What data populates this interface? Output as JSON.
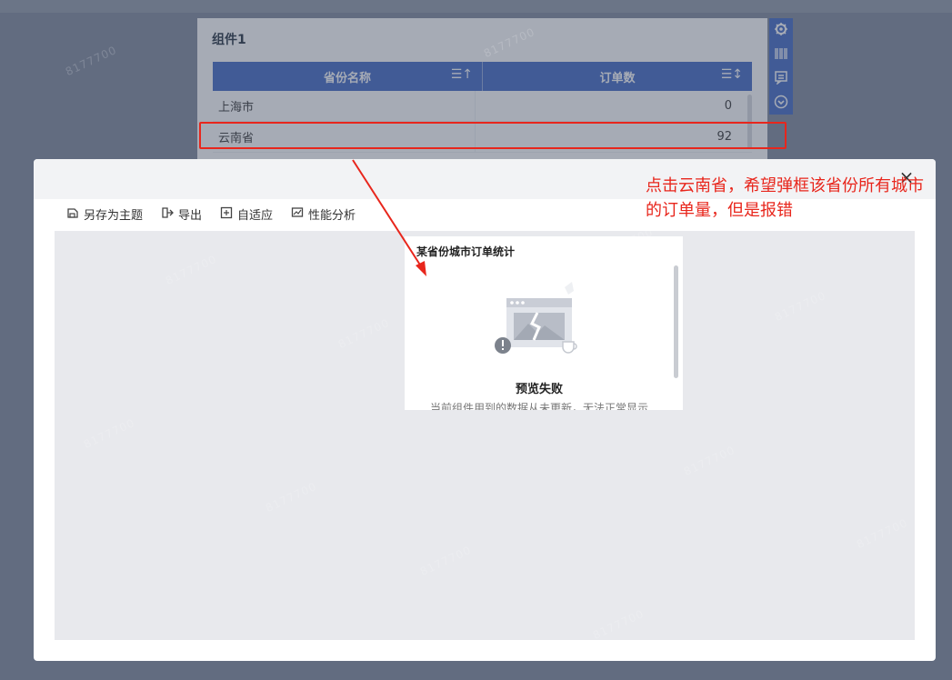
{
  "widget": {
    "title": "组件1",
    "columns": [
      "省份名称",
      "订单数"
    ],
    "sort_icons": [
      "☰↑",
      "☰↕"
    ],
    "rows": [
      {
        "province": "上海市",
        "orders": "0"
      },
      {
        "province": "云南省",
        "orders": "92"
      }
    ]
  },
  "side_toolbar": {
    "icons": [
      "gear-icon",
      "barcode-icon",
      "comment-icon",
      "chevron-down-circle-icon"
    ]
  },
  "modal": {
    "toolbar": {
      "save_as_theme": "另存为主题",
      "export": "导出",
      "auto_fit": "自适应",
      "performance": "性能分析"
    },
    "close_glyph": "×",
    "preview": {
      "title": "某省份城市订单统计",
      "fail_title": "预览失败",
      "fail_message": "当前组件用到的数据从未更新，无法正常显示"
    }
  },
  "annotation": {
    "text": "点击云南省，希望弹框该省份所有城市的订单量，但是报错",
    "color": "#e8261c"
  },
  "watermark": "8177700",
  "colors": {
    "accent": "#3e66c4",
    "annotation_red": "#e8261c"
  }
}
